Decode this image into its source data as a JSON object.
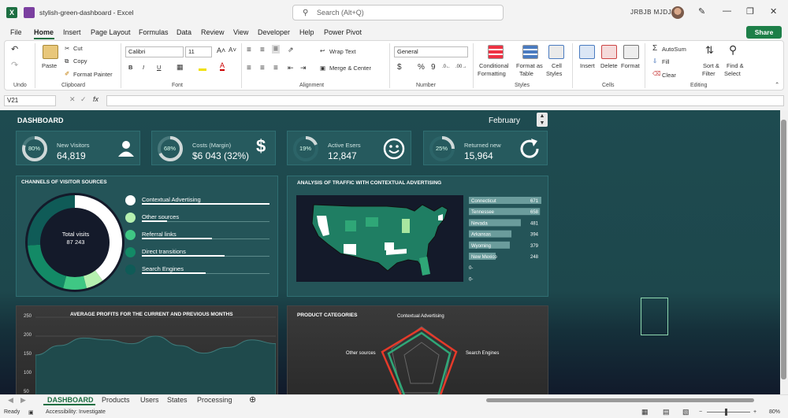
{
  "titlebar": {
    "doc_title": "stylish-green-dashboard  -  Excel",
    "search_placeholder": "Search (Alt+Q)",
    "user_name": "JRBJB MJDJK",
    "minimize": "—",
    "restore": "❐",
    "close": "✕"
  },
  "menu": [
    "File",
    "Home",
    "Insert",
    "Page Layout",
    "Formulas",
    "Data",
    "Review",
    "View",
    "Developer",
    "Help",
    "Power Pivot"
  ],
  "share_label": "Share",
  "ribbon": {
    "undo_label": "Undo",
    "clipboard": {
      "label": "Clipboard",
      "paste": "Paste",
      "cut": "Cut",
      "copy": "Copy",
      "painter": "Format Painter"
    },
    "font": {
      "label": "Font",
      "family": "Calibri",
      "size": "11",
      "bold": "B",
      "italic": "I",
      "underline": "U"
    },
    "alignment": {
      "label": "Alignment",
      "wrap": "Wrap Text",
      "merge": "Merge & Center"
    },
    "number": {
      "label": "Number",
      "format": "General",
      "currency": "$",
      "percent": "%",
      "comma": "9"
    },
    "styles": {
      "label": "Styles",
      "cond1": "Conditional",
      "cond2": "Formatting",
      "fmt1": "Format as",
      "fmt2": "Table",
      "cell1": "Cell",
      "cell2": "Styles"
    },
    "cells": {
      "label": "Cells",
      "insert": "Insert",
      "delete": "Delete",
      "format": "Format"
    },
    "editing": {
      "label": "Editing",
      "autosum": "AutoSum",
      "fill": "Fill",
      "clear": "Clear",
      "sort1": "Sort &",
      "sort2": "Filter",
      "find1": "Find &",
      "find2": "Select"
    }
  },
  "formula_bar": {
    "name_box": "V21",
    "fx": "fx"
  },
  "dashboard": {
    "title": "DASHBOARD",
    "month": "February",
    "kpis": [
      {
        "pct": "80%",
        "label": "New Visitors",
        "value": "64,819",
        "icon": "user-icon",
        "fraction": 0.8
      },
      {
        "pct": "68%",
        "label": "Costs (Margin)",
        "value": "$6 043 (32%)",
        "icon": "dollar-icon",
        "fraction": 0.68
      },
      {
        "pct": "19%",
        "label": "Active Esers",
        "value": "12,847",
        "icon": "smiley-icon",
        "fraction": 0.19
      },
      {
        "pct": "25%",
        "label": "Returned new",
        "value": "15,964",
        "icon": "refresh-icon",
        "fraction": 0.25
      }
    ],
    "channels": {
      "title": "CHANNELS OF VISITOR SOURCES",
      "center_label": "Total visits",
      "center_value": "87 243",
      "items": [
        {
          "label": "Contextual Advertising",
          "color": "#ffffff",
          "fraction": 1.0
        },
        {
          "label": "Other sources",
          "color": "#b6f0b0",
          "fraction": 0.2
        },
        {
          "label": "Referral links",
          "color": "#3fc784",
          "fraction": 0.55
        },
        {
          "label": "Direct transitions",
          "color": "#138a66",
          "fraction": 0.65
        },
        {
          "label": "Search Engines",
          "color": "#0f5b57",
          "fraction": 0.5
        }
      ]
    },
    "traffic": {
      "title": "ANALYSIS OF TRAFFIC WITH CONTEXTUAL ADVERTISING",
      "rows": [
        {
          "state": "Connecticut",
          "value": "671",
          "num": 671
        },
        {
          "state": "Tennessee",
          "value": "658",
          "num": 658
        },
        {
          "state": "Nevada",
          "value": "481",
          "num": 481
        },
        {
          "state": "Arkansas",
          "value": "394",
          "num": 394
        },
        {
          "state": "Wyoming",
          "value": "379",
          "num": 379
        },
        {
          "state": "New Mexico",
          "value": "248",
          "num": 248
        },
        {
          "state": "",
          "value": "0-",
          "num": 0
        },
        {
          "state": "",
          "value": "0-",
          "num": 0
        }
      ]
    },
    "profits": {
      "title": "AVERAGE PROFITS FOR THE CURRENT AND PREVIOUS MONTHS",
      "yticks": [
        "250",
        "200",
        "150",
        "100",
        "50"
      ]
    },
    "categories": {
      "title": "PRODUCT CATEGORIES",
      "axes": [
        "Contextual Advertising",
        "Search Engines",
        "Other sources"
      ]
    }
  },
  "chart_data": [
    {
      "type": "pie",
      "title": "CHANNELS OF VISITOR SOURCES",
      "categories": [
        "Contextual Advertising",
        "Other sources",
        "Referral links",
        "Direct transitions",
        "Search Engines"
      ],
      "values": [
        40,
        6,
        8,
        20,
        26
      ]
    },
    {
      "type": "bar",
      "title": "ANALYSIS OF TRAFFIC WITH CONTEXTUAL ADVERTISING",
      "categories": [
        "Connecticut",
        "Tennessee",
        "Nevada",
        "Arkansas",
        "Wyoming",
        "New Mexico"
      ],
      "values": [
        671,
        658,
        481,
        394,
        379,
        248
      ]
    },
    {
      "type": "area",
      "title": "AVERAGE PROFITS FOR THE CURRENT AND PREVIOUS MONTHS",
      "ylim": [
        50,
        250
      ],
      "values": [
        150,
        175,
        195,
        190,
        180,
        200,
        175,
        155,
        170,
        190,
        180
      ]
    }
  ],
  "sheet_tabs": [
    "DASHBOARD",
    "Products",
    "Users",
    "States",
    "Processing"
  ],
  "status": {
    "ready": "Ready",
    "accessibility": "Accessibility: Investigate",
    "zoom": "80%"
  }
}
